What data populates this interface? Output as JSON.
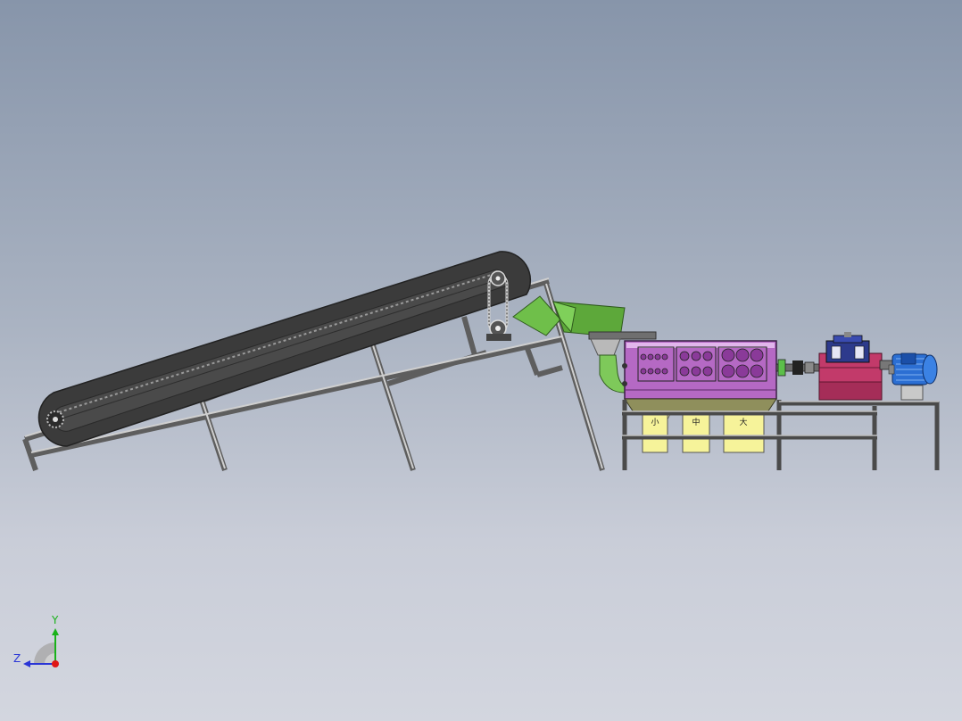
{
  "bins": {
    "labels": [
      "小",
      "中",
      "大"
    ]
  },
  "triad": {
    "y_label": "Y",
    "z_label": "Z",
    "colors": {
      "y": "#19b219",
      "z": "#2a35d6",
      "x": "#e01616"
    }
  },
  "colors": {
    "background_top": "#8795aa",
    "background_bottom": "#d3d6df",
    "frame": "#6b6b6b",
    "belt": "#3b3b3b",
    "hopper": "#6fbf4a",
    "screen_body": "#b569c4",
    "screen_base": "#8f8f5c",
    "bin": "#f6f39a",
    "gearbox": "#c23a6a",
    "motor": "#2c6fd3"
  }
}
